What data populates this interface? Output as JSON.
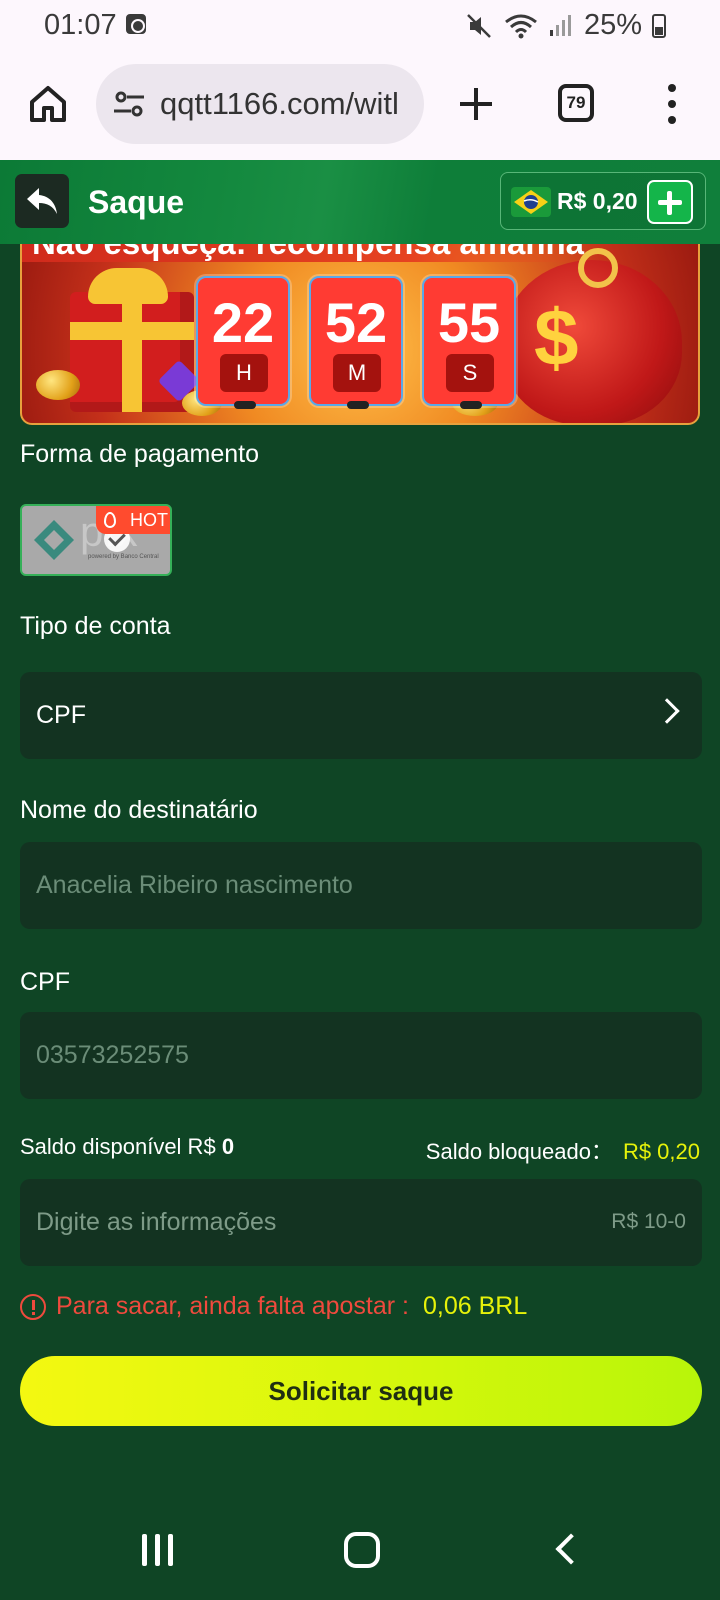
{
  "status_bar": {
    "time": "01:07",
    "battery": "25%"
  },
  "browser": {
    "url": "qqtt1166.com/witl",
    "tab_count": "79"
  },
  "header": {
    "title": "Saque",
    "balance": "R$ 0,20"
  },
  "banner": {
    "text": "Não esqueça: recompensa amanhã",
    "countdown": [
      {
        "value": "22",
        "unit": "H"
      },
      {
        "value": "52",
        "unit": "M"
      },
      {
        "value": "55",
        "unit": "S"
      }
    ]
  },
  "payment": {
    "label": "Forma de pagamento",
    "method": "pix",
    "method_subtitle": "powered by Banco Central",
    "badge": "HOT"
  },
  "account_type": {
    "label": "Tipo de conta",
    "value": "CPF"
  },
  "recipient": {
    "label": "Nome do destinatário",
    "placeholder": "Anacelia Ribeiro nascimento"
  },
  "cpf": {
    "label": "CPF",
    "placeholder": "03573252575"
  },
  "saldo": {
    "available_label": "Saldo disponível R$",
    "available_value": "0",
    "blocked_label": "Saldo bloqueado：",
    "blocked_value": "R$ 0,20"
  },
  "amount": {
    "placeholder": "Digite as informações",
    "range": "R$ 10-0"
  },
  "warning": {
    "text": "Para sacar, ainda falta apostar :",
    "value": "0,06 BRL"
  },
  "submit": {
    "label": "Solicitar saque"
  },
  "colors": {
    "background": "#0f4525",
    "header_green": "#13883e",
    "field_bg": "#133321",
    "accent_yellow": "#e6f20a",
    "warning_red": "#ef4a3d"
  }
}
